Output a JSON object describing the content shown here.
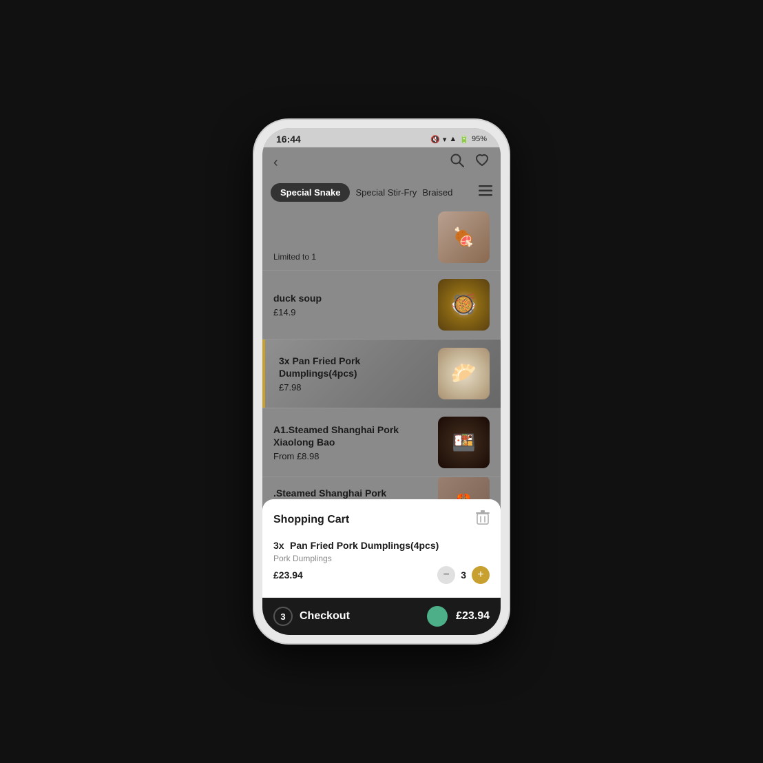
{
  "status_bar": {
    "time": "16:44",
    "battery": "95%",
    "mute_icon": "🔇",
    "wifi_icon": "▲",
    "signal_icon": "📶"
  },
  "header": {
    "back_label": "‹",
    "search_icon": "search",
    "heart_icon": "heart"
  },
  "categories": {
    "active_tab": "Special Snake",
    "tabs": [
      "Special Snake",
      "Special Stir-Fry",
      "Braised"
    ]
  },
  "menu_items": [
    {
      "id": "item-top-partial",
      "limit": "Limited to 1",
      "image_type": "partial"
    },
    {
      "id": "duck-soup",
      "name": "duck soup",
      "price": "£14.9",
      "image_type": "duck-soup"
    },
    {
      "id": "pan-fried-dumplings",
      "name": "3x Pan Fried Pork Dumplings(4pcs)",
      "price": "£7.98",
      "image_type": "dumplings",
      "is_active": true
    },
    {
      "id": "steamed-xiaolong",
      "name": "A1.Steamed Shanghai Pork Xiaolong Bao",
      "price": "From £8.98",
      "image_type": "xiaolong"
    },
    {
      "id": "steamed-crab",
      "name": ".Steamed Shanghai Pork Xiaolong Bao with Crab Meat",
      "price": "",
      "image_type": "crab",
      "is_partial": true
    }
  ],
  "cart": {
    "title": "Shopping Cart",
    "delete_icon": "🗑",
    "item": {
      "quantity_prefix": "3x",
      "name": "Pan Fried Pork Dumplings(4pcs)",
      "description": "Pork Dumplings",
      "price": "£23.94",
      "quantity": 3
    }
  },
  "checkout": {
    "count": 3,
    "label": "Checkout",
    "total": "£23.94"
  }
}
